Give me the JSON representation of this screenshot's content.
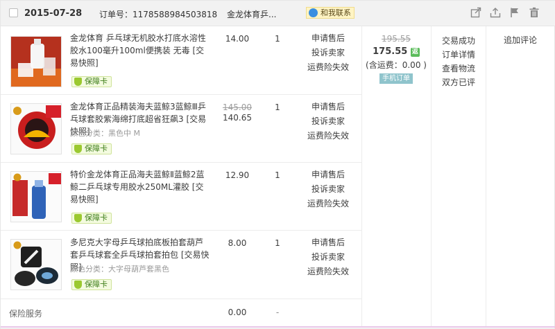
{
  "header": {
    "date": "2015-07-28",
    "order_label": "订单号：1178588984503818",
    "shop": "金龙体育乒...",
    "contact": "和我联系"
  },
  "items": [
    {
      "title": "金龙体育 乒乓球无机胶水打底水溶性胶水100毫升100ml便携装 无毒 [交易快照]",
      "spec": "",
      "badge": "保障卡",
      "orig_price": "",
      "price": "14.00",
      "qty": "1",
      "services": [
        "申请售后",
        "投诉卖家",
        "运费险失效"
      ]
    },
    {
      "title": "金龙体育正品精装海夫蓝鲸3蓝鲸Ⅲ乒乓球套胶紫海绵打底超省狂飙3 [交易快照]",
      "spec": "颜色分类：黑色中 M",
      "badge": "保障卡",
      "orig_price": "145.00",
      "price": "140.65",
      "qty": "1",
      "services": [
        "申请售后",
        "投诉卖家",
        "运费险失效"
      ]
    },
    {
      "title": "特价金龙体育正品海夫蓝鲸Ⅱ蓝鲸2蓝鲸二乒乓球专用胶水250ML灌胶 [交易快照]",
      "spec": "",
      "badge": "保障卡",
      "orig_price": "",
      "price": "12.90",
      "qty": "1",
      "services": [
        "申请售后",
        "投诉卖家",
        "运费险失效"
      ]
    },
    {
      "title": "多尼克大字母乒乓球拍底板拍套葫芦套乒乓球套全乒乓球拍套拍包 [交易快照]",
      "spec": "颜色分类：大字母葫芦套黑色",
      "badge": "保障卡",
      "orig_price": "",
      "price": "8.00",
      "qty": "1",
      "services": [
        "申请售后",
        "投诉卖家",
        "运费险失效"
      ]
    }
  ],
  "insurance": {
    "label": "保险服务",
    "price": "0.00",
    "qty": "-"
  },
  "summary": {
    "orig_total": "195.55",
    "total": "175.55",
    "coin": "返",
    "shipping": "(含运费：0.00 )",
    "mobile": "手机订单"
  },
  "status": {
    "lines": [
      "交易成功",
      "订单详情",
      "查看物流",
      "双方已评"
    ]
  },
  "review": {
    "label": "追加评论"
  },
  "colors": {
    "header_bg": "#f2f2f2",
    "badge_green": "#9bc930",
    "mobile_tag": "#8fc4cc"
  },
  "icons": [
    "checkbox-icon",
    "qq-icon",
    "share-icon",
    "upload-icon",
    "flag-icon",
    "trash-icon",
    "shield-icon"
  ]
}
